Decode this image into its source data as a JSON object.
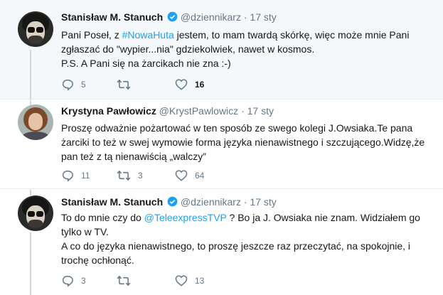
{
  "tweets": [
    {
      "author_name": "Stanisław M. Stanuch",
      "handle": "@dziennikarz",
      "separator": "·",
      "date": "17 sty",
      "verified": true,
      "text_parts": {
        "line1_a": "Pani Poseł, z ",
        "line1_hashtag": "#NowaHuta",
        "line1_b": " jestem, to mam twardą skórkę, więc może mnie Pani zgłaszać do \"wypier...nia\" gdziekolwiek, nawet w kosmos.",
        "line2": "P.S. A Pani się na żarcikach nie zna :-)"
      },
      "replies": "5",
      "retweets": "",
      "likes": "16"
    },
    {
      "author_name": "Krystyna Pawłowicz",
      "handle": "@KrystPawlowicz",
      "separator": "·",
      "date": "17 sty",
      "verified": false,
      "text": "Proszę odważnie pożartować w ten sposób ze swego kolegi J.Owsiaka.Te pana żarciki to też w swej wymowie forma języka nienawistnego i szczującego.Widzę,że pan też z tą nienawiścią „walczy”",
      "replies": "11",
      "retweets": "3",
      "likes": "64"
    },
    {
      "author_name": "Stanisław M. Stanuch",
      "handle": "@dziennikarz",
      "separator": "·",
      "date": "17 sty",
      "verified": true,
      "text_parts": {
        "line1_a": "To do mnie czy do ",
        "line1_mention": "@TeleexpressTVP",
        "line1_b": " ? Bo ja J. Owsiaka nie znam. Widziałem go tylko w TV.",
        "line2": "A co do języka nienawistnego, to proszę jeszcze raz przeczytać, na spokojnie, i trochę ochłonąć."
      },
      "replies": "3",
      "retweets": "",
      "likes": "13"
    }
  ],
  "icons": {
    "verified": "verified-badge-icon",
    "reply": "reply-icon",
    "retweet": "retweet-icon",
    "like": "heart-icon"
  },
  "colors": {
    "link": "#1da1f2",
    "verified": "#1da1f2",
    "muted": "#657786",
    "highlight_bg": "#f5f8fa"
  }
}
